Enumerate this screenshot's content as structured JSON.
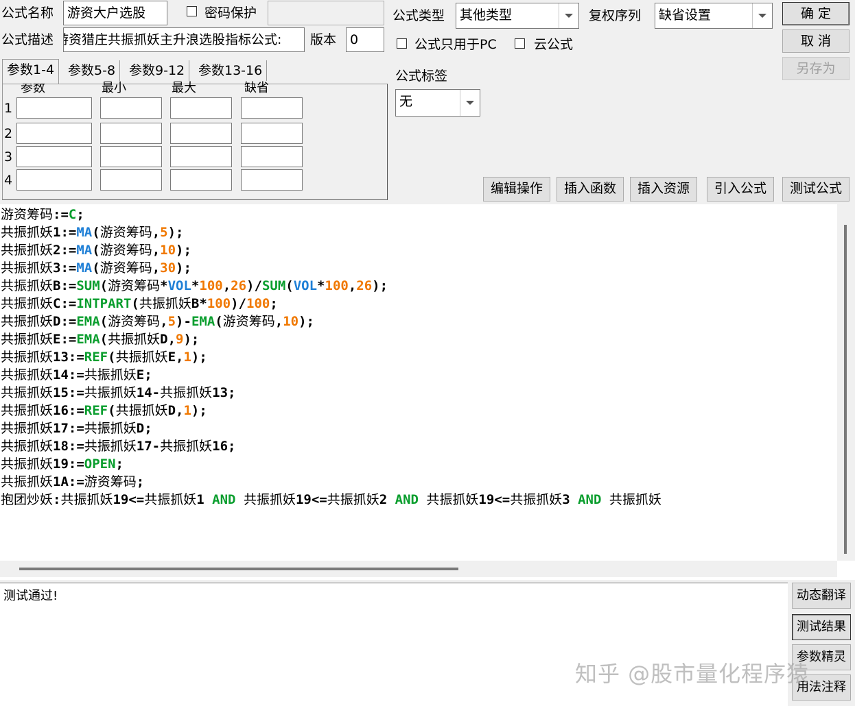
{
  "header": {
    "name_label": "公式名称",
    "name_value": "游资大户选股",
    "password_label": "密码保护",
    "desc_label": "公式描述",
    "desc_value": "游资猎庄共振抓妖主升浪选股指标公式:",
    "version_label": "版本",
    "version_value": "0",
    "type_label": "公式类型",
    "type_value": "其他类型",
    "rights_label": "复权序列",
    "rights_value": "缺省设置",
    "pc_only_label": "公式只用于PC",
    "cloud_label": "云公式",
    "tag_label": "公式标签",
    "tag_value": "无"
  },
  "buttons": {
    "ok": "确  定",
    "cancel": "取  消",
    "save_as": "另存为",
    "edit_ops": "编辑操作",
    "insert_func": "插入函数",
    "insert_res": "插入资源",
    "import_formula": "引入公式",
    "test_formula": "测试公式"
  },
  "tabs": [
    {
      "label": "参数1-4"
    },
    {
      "label": "参数5-8"
    },
    {
      "label": "参数9-12"
    },
    {
      "label": "参数13-16"
    }
  ],
  "params": {
    "headers": [
      "参数",
      "最小",
      "最大",
      "缺省"
    ],
    "rows": [
      "1",
      "2",
      "3",
      "4"
    ]
  },
  "code": [
    [
      [
        "cn",
        "游资筹码"
      ],
      [
        "t",
        ":="
      ],
      [
        "f",
        "C"
      ],
      [
        "t",
        ";"
      ]
    ],
    [
      [
        "cn",
        "共振抓妖"
      ],
      [
        "t",
        "1:="
      ],
      [
        "m",
        "MA"
      ],
      [
        "t",
        "("
      ],
      [
        "cn",
        "游资筹码"
      ],
      [
        "t",
        ","
      ],
      [
        "n",
        "5"
      ],
      [
        "t",
        ");"
      ]
    ],
    [
      [
        "cn",
        "共振抓妖"
      ],
      [
        "t",
        "2:="
      ],
      [
        "m",
        "MA"
      ],
      [
        "t",
        "("
      ],
      [
        "cn",
        "游资筹码"
      ],
      [
        "t",
        ","
      ],
      [
        "n",
        "10"
      ],
      [
        "t",
        ");"
      ]
    ],
    [
      [
        "cn",
        "共振抓妖"
      ],
      [
        "t",
        "3:="
      ],
      [
        "m",
        "MA"
      ],
      [
        "t",
        "("
      ],
      [
        "cn",
        "游资筹码"
      ],
      [
        "t",
        ","
      ],
      [
        "n",
        "30"
      ],
      [
        "t",
        ");"
      ]
    ],
    [
      [
        "cn",
        "共振抓妖"
      ],
      [
        "t",
        "B:="
      ],
      [
        "f",
        "SUM"
      ],
      [
        "t",
        "("
      ],
      [
        "cn",
        "游资筹码"
      ],
      [
        "t",
        "*"
      ],
      [
        "m",
        "VOL"
      ],
      [
        "t",
        "*"
      ],
      [
        "n",
        "100"
      ],
      [
        "t",
        ","
      ],
      [
        "n",
        "26"
      ],
      [
        "t",
        ")/"
      ],
      [
        "f",
        "SUM"
      ],
      [
        "t",
        "("
      ],
      [
        "m",
        "VOL"
      ],
      [
        "t",
        "*"
      ],
      [
        "n",
        "100"
      ],
      [
        "t",
        ","
      ],
      [
        "n",
        "26"
      ],
      [
        "t",
        ");"
      ]
    ],
    [
      [
        "cn",
        "共振抓妖"
      ],
      [
        "t",
        "C:="
      ],
      [
        "f",
        "INTPART"
      ],
      [
        "t",
        "("
      ],
      [
        "cn",
        "共振抓妖"
      ],
      [
        "t",
        "B*"
      ],
      [
        "n",
        "100"
      ],
      [
        "t",
        ")/"
      ],
      [
        "n",
        "100"
      ],
      [
        "t",
        ";"
      ]
    ],
    [
      [
        "cn",
        "共振抓妖"
      ],
      [
        "t",
        "D:="
      ],
      [
        "f",
        "EMA"
      ],
      [
        "t",
        "("
      ],
      [
        "cn",
        "游资筹码"
      ],
      [
        "t",
        ","
      ],
      [
        "n",
        "5"
      ],
      [
        "t",
        ")-"
      ],
      [
        "f",
        "EMA"
      ],
      [
        "t",
        "("
      ],
      [
        "cn",
        "游资筹码"
      ],
      [
        "t",
        ","
      ],
      [
        "n",
        "10"
      ],
      [
        "t",
        ");"
      ]
    ],
    [
      [
        "cn",
        "共振抓妖"
      ],
      [
        "t",
        "E:="
      ],
      [
        "f",
        "EMA"
      ],
      [
        "t",
        "("
      ],
      [
        "cn",
        "共振抓妖"
      ],
      [
        "t",
        "D,"
      ],
      [
        "n",
        "9"
      ],
      [
        "t",
        ");"
      ]
    ],
    [
      [
        "cn",
        "共振抓妖"
      ],
      [
        "t",
        "13:="
      ],
      [
        "f",
        "REF"
      ],
      [
        "t",
        "("
      ],
      [
        "cn",
        "共振抓妖"
      ],
      [
        "t",
        "E,"
      ],
      [
        "n",
        "1"
      ],
      [
        "t",
        ");"
      ]
    ],
    [
      [
        "cn",
        "共振抓妖"
      ],
      [
        "t",
        "14:="
      ],
      [
        "cn",
        "共振抓妖"
      ],
      [
        "t",
        "E;"
      ]
    ],
    [
      [
        "cn",
        "共振抓妖"
      ],
      [
        "t",
        "15:="
      ],
      [
        "cn",
        "共振抓妖"
      ],
      [
        "t",
        "14-"
      ],
      [
        "cn",
        "共振抓妖"
      ],
      [
        "t",
        "13;"
      ]
    ],
    [
      [
        "cn",
        "共振抓妖"
      ],
      [
        "t",
        "16:="
      ],
      [
        "f",
        "REF"
      ],
      [
        "t",
        "("
      ],
      [
        "cn",
        "共振抓妖"
      ],
      [
        "t",
        "D,"
      ],
      [
        "n",
        "1"
      ],
      [
        "t",
        ");"
      ]
    ],
    [
      [
        "cn",
        "共振抓妖"
      ],
      [
        "t",
        "17:="
      ],
      [
        "cn",
        "共振抓妖"
      ],
      [
        "t",
        "D;"
      ]
    ],
    [
      [
        "cn",
        "共振抓妖"
      ],
      [
        "t",
        "18:="
      ],
      [
        "cn",
        "共振抓妖"
      ],
      [
        "t",
        "17-"
      ],
      [
        "cn",
        "共振抓妖"
      ],
      [
        "t",
        "16;"
      ]
    ],
    [
      [
        "cn",
        "共振抓妖"
      ],
      [
        "t",
        "19:="
      ],
      [
        "f",
        "OPEN"
      ],
      [
        "t",
        ";"
      ]
    ],
    [
      [
        "cn",
        "共振抓妖"
      ],
      [
        "t",
        "1A:="
      ],
      [
        "cn",
        "游资筹码"
      ],
      [
        "t",
        ";"
      ]
    ],
    [
      [
        "cn",
        "抱团炒妖"
      ],
      [
        "t",
        ":"
      ],
      [
        "cn",
        "共振抓妖"
      ],
      [
        "t",
        "19<="
      ],
      [
        "cn",
        "共振抓妖"
      ],
      [
        "t",
        "1 "
      ],
      [
        "f",
        "AND"
      ],
      [
        "t",
        " "
      ],
      [
        "cn",
        "共振抓妖"
      ],
      [
        "t",
        "19<="
      ],
      [
        "cn",
        "共振抓妖"
      ],
      [
        "t",
        "2 "
      ],
      [
        "f",
        "AND"
      ],
      [
        "t",
        " "
      ],
      [
        "cn",
        "共振抓妖"
      ],
      [
        "t",
        "19<="
      ],
      [
        "cn",
        "共振抓妖"
      ],
      [
        "t",
        "3 "
      ],
      [
        "f",
        "AND"
      ],
      [
        "t",
        " "
      ],
      [
        "cn",
        "共振抓妖"
      ]
    ]
  ],
  "result_text": "测试通过!",
  "side_buttons": [
    "动态翻译",
    "测试结果",
    "参数精灵",
    "用法注释"
  ],
  "watermark": "知乎 @股市量化程序猿"
}
